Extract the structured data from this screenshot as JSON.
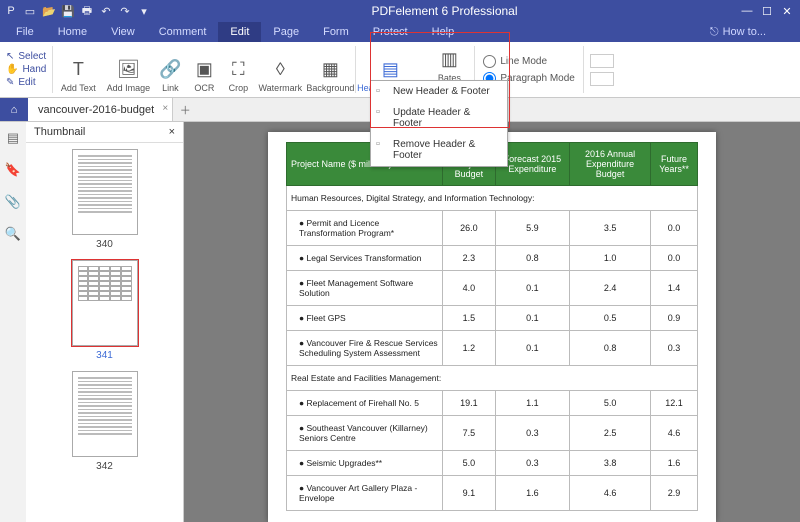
{
  "app": {
    "title": "PDFelement 6 Professional"
  },
  "menu": {
    "tabs": [
      "File",
      "Home",
      "View",
      "Comment",
      "Edit",
      "Page",
      "Form",
      "Protect",
      "Help"
    ],
    "active": "Edit",
    "howto": "How to..."
  },
  "ribbon": {
    "left_tools": {
      "select": "Select",
      "hand": "Hand",
      "edit": "Edit"
    },
    "addText": "Add Text",
    "addImage": "Add Image",
    "link": "Link",
    "ocr": "OCR",
    "crop": "Crop",
    "watermark": "Watermark",
    "background": "Background",
    "headerFooter": "Header & Footer",
    "bates": "Bates\nNumbering",
    "lineMode": "Line Mode",
    "paragraphMode": "Paragraph Mode"
  },
  "dropdown": {
    "items": [
      "New Header & Footer",
      "Update Header & Footer",
      "Remove Header & Footer"
    ]
  },
  "tabstrip": {
    "docName": "vancouver-2016-budget"
  },
  "thumbs": {
    "title": "Thumbnail",
    "pages": [
      "340",
      "341",
      "342"
    ],
    "selectedIndex": 1
  },
  "table": {
    "headers": [
      "Project Name ($ millions)",
      "Total Project Budget",
      "Forecast 2015 Expenditure",
      "2016 Annual Expenditure Budget",
      "Future Years**"
    ],
    "section1": "Human Resources, Digital Strategy, and Information Technology:",
    "rows1": [
      {
        "name": "● Permit and Licence Transformation Program*",
        "c": [
          "26.0",
          "5.9",
          "3.5",
          "0.0"
        ]
      },
      {
        "name": "● Legal Services Transformation",
        "c": [
          "2.3",
          "0.8",
          "1.0",
          "0.0"
        ]
      },
      {
        "name": "● Fleet Management Software Solution",
        "c": [
          "4.0",
          "0.1",
          "2.4",
          "1.4"
        ]
      },
      {
        "name": "● Fleet GPS",
        "c": [
          "1.5",
          "0.1",
          "0.5",
          "0.9"
        ]
      },
      {
        "name": "● Vancouver Fire & Rescue Services Scheduling System Assessment",
        "c": [
          "1.2",
          "0.1",
          "0.8",
          "0.3"
        ]
      }
    ],
    "section2": "Real Estate and Facilities Management:",
    "rows2": [
      {
        "name": "● Replacement of Firehall No. 5",
        "c": [
          "19.1",
          "1.1",
          "5.0",
          "12.1"
        ]
      },
      {
        "name": "● Southeast Vancouver (Killarney) Seniors Centre",
        "c": [
          "7.5",
          "0.3",
          "2.5",
          "4.6"
        ]
      },
      {
        "name": "● Seismic Upgrades**",
        "c": [
          "5.0",
          "0.3",
          "3.8",
          "1.6"
        ]
      },
      {
        "name": "● Vancouver Art Gallery Plaza - Envelope",
        "c": [
          "9.1",
          "1.6",
          "4.6",
          "2.9"
        ]
      }
    ]
  }
}
